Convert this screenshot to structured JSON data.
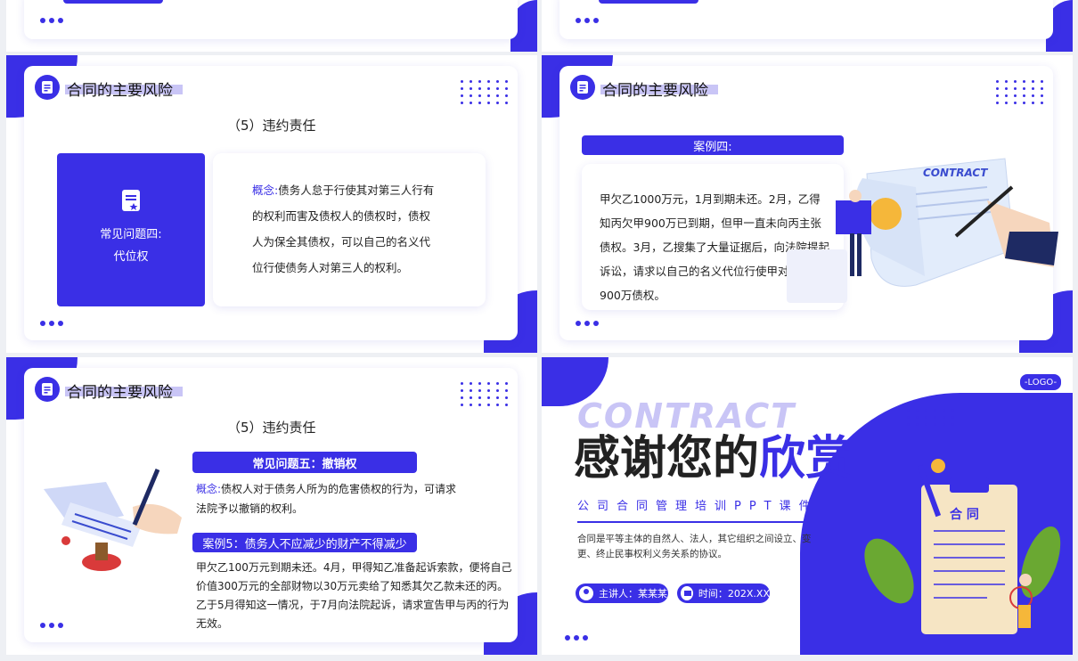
{
  "header_title": "合同的主要风险",
  "slide1": {
    "subtitle": "（5）违约责任",
    "box_line1": "常见问题四:",
    "box_line2": "代位权",
    "concept_label": "概念:",
    "concept_text": "债务人怠于行使其对第三人行有的权利而害及债权人的债权时，债权人为保全其债权，可以自己的名义代位行使债务人对第三人的权利。"
  },
  "slide2": {
    "case_label": "案例四:",
    "case_text": "甲欠乙1000万元，1月到期未还。2月，乙得知丙欠甲900万已到期，但甲一直未向丙主张债权。3月，乙搜集了大量证据后，向法院提起诉讼，请求以自己的名义代位行使甲对丙的900万债权。",
    "contract_word": "CONTRACT"
  },
  "slide3": {
    "subtitle": "（5）违约责任",
    "q_label": "常见问题五：撤销权",
    "concept_label": "概念:",
    "concept_text": "债权人对于债务人所为的危害债权的行为，可请求法院予以撤销的权利。",
    "case_label": "案例5：债务人不应减少的财产不得减少",
    "case_text": "甲欠乙100万元到期未还。4月，甲得知乙准备起诉索款，便将自己价值300万元的全部财物以30万元卖给了知悉其欠乙款未还的丙。乙于5月得知这一情况，于7月向法院起诉，请求宣告甲与丙的行为无效。"
  },
  "slide4": {
    "logo": "-LOGO-",
    "contract_word": "CONTRACT",
    "thanks_a": "感谢您的",
    "thanks_b": "欣赏",
    "course": "公司合同管理培训PPT课件",
    "desc": "合同是平等主体的自然人、法人，其它组织之间设立、变更、终止民事权利义务关系的协议。",
    "speaker": "主讲人：某某某",
    "time": "时间：202X.XX",
    "clip_label": "合 同"
  },
  "colors": {
    "accent": "#3a2fe6",
    "accent_light": "#c9c5f6"
  }
}
